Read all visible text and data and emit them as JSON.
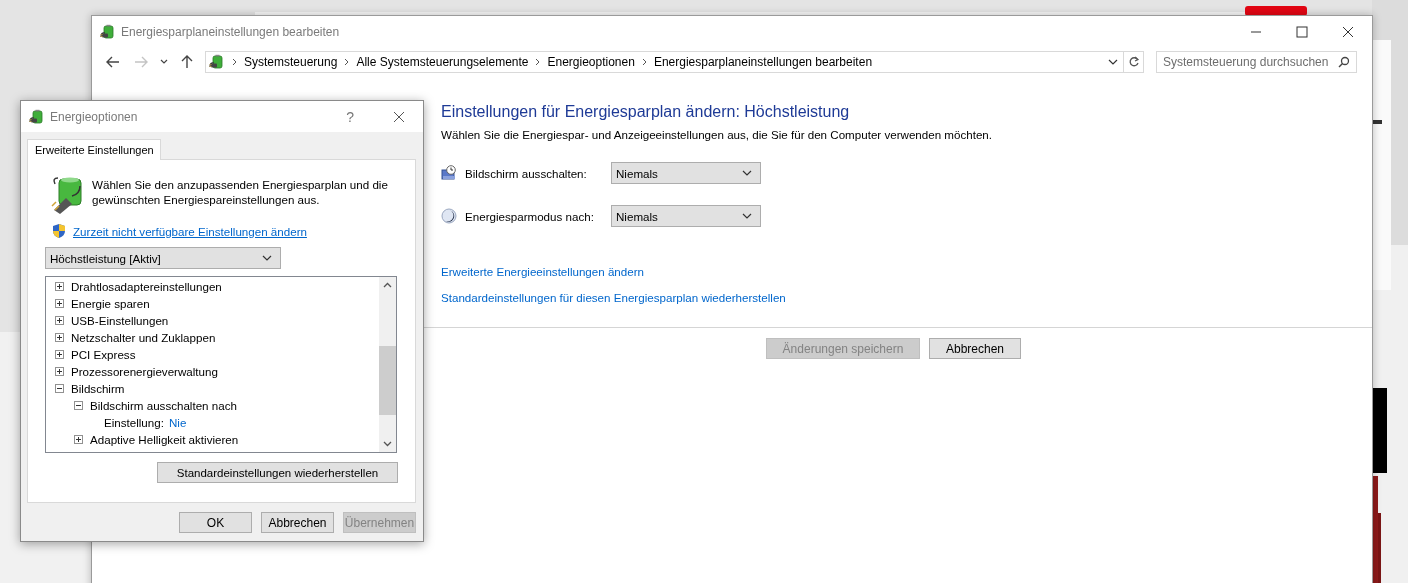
{
  "main_window": {
    "title": "Energiesparplaneinstellungen bearbeiten",
    "nav_buttons": [
      {
        "kind": "back",
        "disabled": false
      },
      {
        "kind": "forward",
        "disabled": true
      },
      {
        "kind": "recent",
        "disabled": false
      },
      {
        "kind": "up",
        "disabled": false
      }
    ],
    "breadcrumbs": [
      "Systemsteuerung",
      "Alle Systemsteuerungselemente",
      "Energieoptionen",
      "Energiesparplaneinstellungen bearbeiten"
    ],
    "search": {
      "placeholder": "Systemsteuerung durchsuchen"
    },
    "heading": "Einstellungen für Energiesparplan ändern: Höchstleistung",
    "description": "Wählen Sie die Energiespar- und Anzeigeeinstellungen aus, die Sie für den Computer verwenden möchten.",
    "settings": [
      {
        "kind": "display",
        "label": "Bildschirm ausschalten:",
        "value": "Niemals"
      },
      {
        "kind": "sleep",
        "label": "Energiesparmodus nach:",
        "value": "Niemals"
      }
    ],
    "links": [
      "Erweiterte Energieeinstellungen ändern",
      "Standardeinstellungen für diesen Energiesparplan wiederherstellen"
    ],
    "buttons": [
      {
        "label": "Änderungen speichern",
        "disabled": true
      },
      {
        "label": "Abbrechen",
        "disabled": false
      }
    ]
  },
  "dialog": {
    "title": "Energieoptionen",
    "help": "?",
    "tabs": [
      {
        "label": "Erweiterte Einstellungen",
        "selected": true
      }
    ],
    "intro": "Wählen Sie den anzupassenden Energiesparplan und die gewünschten Energiespareinstellungen aus.",
    "admin_link": "Zurzeit nicht verfügbare Einstellungen ändern",
    "plan": "Höchstleistung [Aktiv]",
    "tree": [
      {
        "label": "Drahtlosadaptereinstellungen",
        "expanded": false
      },
      {
        "label": "Energie sparen",
        "expanded": false
      },
      {
        "label": "USB-Einstellungen",
        "expanded": false
      },
      {
        "label": "Netzschalter und Zuklappen",
        "expanded": false
      },
      {
        "label": "PCI Express",
        "expanded": false
      },
      {
        "label": "Prozessorenergieverwaltung",
        "expanded": false
      },
      {
        "label": "Bildschirm",
        "expanded": true,
        "children": [
          {
            "label": "Bildschirm ausschalten nach",
            "expanded": true,
            "children": [
              {
                "kind": "setting",
                "label": "Einstellung:",
                "value": "Nie"
              }
            ]
          },
          {
            "label": "Adaptive Helligkeit aktivieren",
            "expanded": false
          }
        ]
      }
    ],
    "restore_button": "Standardeinstellungen wiederherstellen",
    "buttons": [
      {
        "label": "OK",
        "disabled": false
      },
      {
        "label": "Abbrechen",
        "disabled": false
      },
      {
        "label": "Übernehmen",
        "disabled": true
      }
    ]
  }
}
